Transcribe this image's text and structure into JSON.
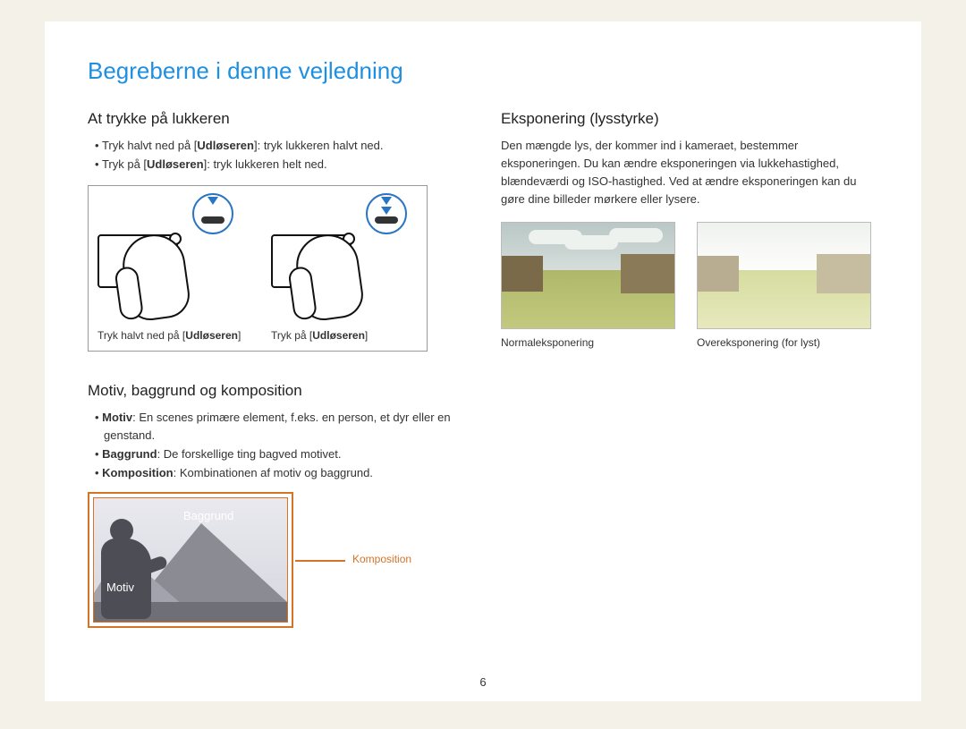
{
  "title": "Begreberne i denne vejledning",
  "pageNumber": "6",
  "left": {
    "shutter": {
      "heading": "At trykke på lukkeren",
      "b1_pre": "Tryk halvt ned på [",
      "b1_bold": "Udløseren",
      "b1_post": "]: tryk lukkeren halvt ned.",
      "b2_pre": "Tryk på [",
      "b2_bold": "Udløseren",
      "b2_post": "]: tryk lukkeren helt ned.",
      "cap1_pre": "Tryk halvt ned på [",
      "cap1_bold": "Udløseren",
      "cap1_post": "]",
      "cap2_pre": "Tryk på [",
      "cap2_bold": "Udløseren",
      "cap2_post": "]"
    },
    "comp": {
      "heading": "Motiv, baggrund og komposition",
      "b1_bold": "Motiv",
      "b1_rest": ": En scenes primære element, f.eks. en person, et dyr eller en genstand.",
      "b2_bold": "Baggrund",
      "b2_rest": ": De forskellige ting bagved motivet.",
      "b3_bold": "Komposition",
      "b3_rest": ": Kombinationen af motiv og baggrund.",
      "label_bag": "Baggrund",
      "label_motiv": "Motiv",
      "label_komp": "Komposition"
    }
  },
  "right": {
    "expo": {
      "heading": "Eksponering (lysstyrke)",
      "para": "Den mængde lys, der kommer ind i kameraet, bestemmer eksponeringen. Du kan ændre eksponeringen via lukkehastighed, blændeværdi og ISO-hastighed. Ved at ændre eksponeringen kan du gøre dine billeder mørkere eller lysere.",
      "cap_normal": "Normaleksponering",
      "cap_over": "Overeksponering (for lyst)"
    }
  }
}
